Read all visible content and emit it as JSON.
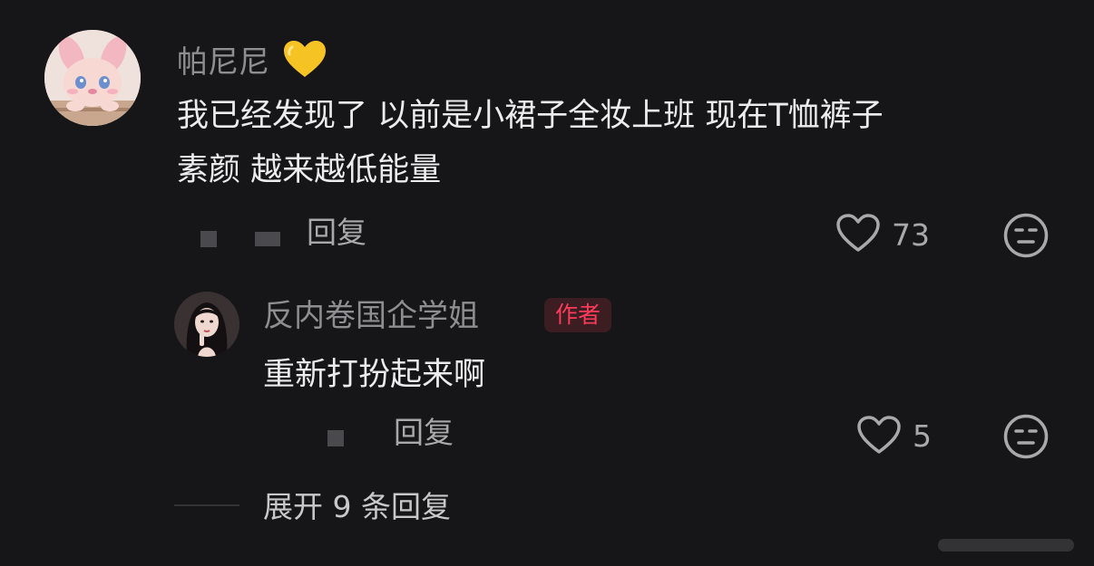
{
  "colors": {
    "background": "#161618",
    "name": "#8d8d92",
    "text": "#ececee",
    "meta": "#a9a9ad",
    "author_badge_text": "#ff3b5c",
    "author_badge_bg": "#3b1d22",
    "heart_emoji": "#f6c325"
  },
  "comment": {
    "author": "帕尼尼",
    "author_emoji": "yellow-heart-icon",
    "text_line1": "我已经发现了 以前是小裙子全妆上班 现在T恤裤子",
    "text_line2": "素颜 越来越低能量",
    "reply_label": "回复",
    "like_count": "73"
  },
  "reply": {
    "author": "反内卷国企学姐",
    "badge": "作者",
    "text": "重新打扮起来啊",
    "reply_label": "回复",
    "like_count": "5"
  },
  "expand_label": "展开 9 条回复"
}
